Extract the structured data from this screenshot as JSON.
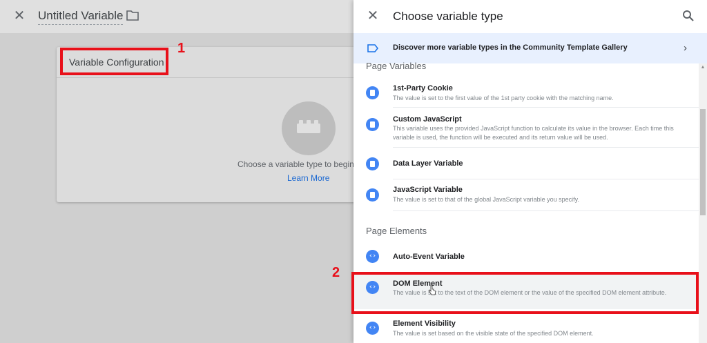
{
  "editor": {
    "close_icon": "close-icon",
    "title": "Untitled Variable",
    "folder_icon": "folder-icon",
    "card_title": "Variable Configuration",
    "choose_text": "Choose a variable type to begin s",
    "learn_more": "Learn More"
  },
  "annotations": {
    "marker_1": "1",
    "marker_2": "2",
    "color": "#e8101a"
  },
  "panel": {
    "close_icon": "close-icon",
    "title": "Choose variable type",
    "search_icon": "search-icon",
    "gallery_text": "Discover more variable types in the Community Template Gallery",
    "sections": [
      {
        "title": "Page Variables",
        "items": [
          {
            "name": "1st-Party Cookie",
            "desc": "The value is set to the first value of the 1st party cookie with the matching name.",
            "icon": "doc-icon"
          },
          {
            "name": "Custom JavaScript",
            "desc": "This variable uses the provided JavaScript function to calculate its value in the browser. Each time this variable is used, the function will be executed and its return value will be used.",
            "icon": "doc-icon"
          },
          {
            "name": "Data Layer Variable",
            "desc": "",
            "icon": "doc-icon"
          },
          {
            "name": "JavaScript Variable",
            "desc": "The value is set to that of the global JavaScript variable you specify.",
            "icon": "doc-icon"
          }
        ]
      },
      {
        "title": "Page Elements",
        "items": [
          {
            "name": "Auto-Event Variable",
            "desc": "",
            "icon": "code-icon"
          },
          {
            "name": "DOM Element",
            "desc": "The value is set to the text of the DOM element or the value of the specified DOM element attribute.",
            "icon": "code-icon"
          },
          {
            "name": "Element Visibility",
            "desc": "The value is set based on the visible state of the specified DOM element.",
            "icon": "code-icon"
          }
        ]
      }
    ],
    "accent": "#4285f4",
    "gallery_bg": "#e8f0fe"
  }
}
